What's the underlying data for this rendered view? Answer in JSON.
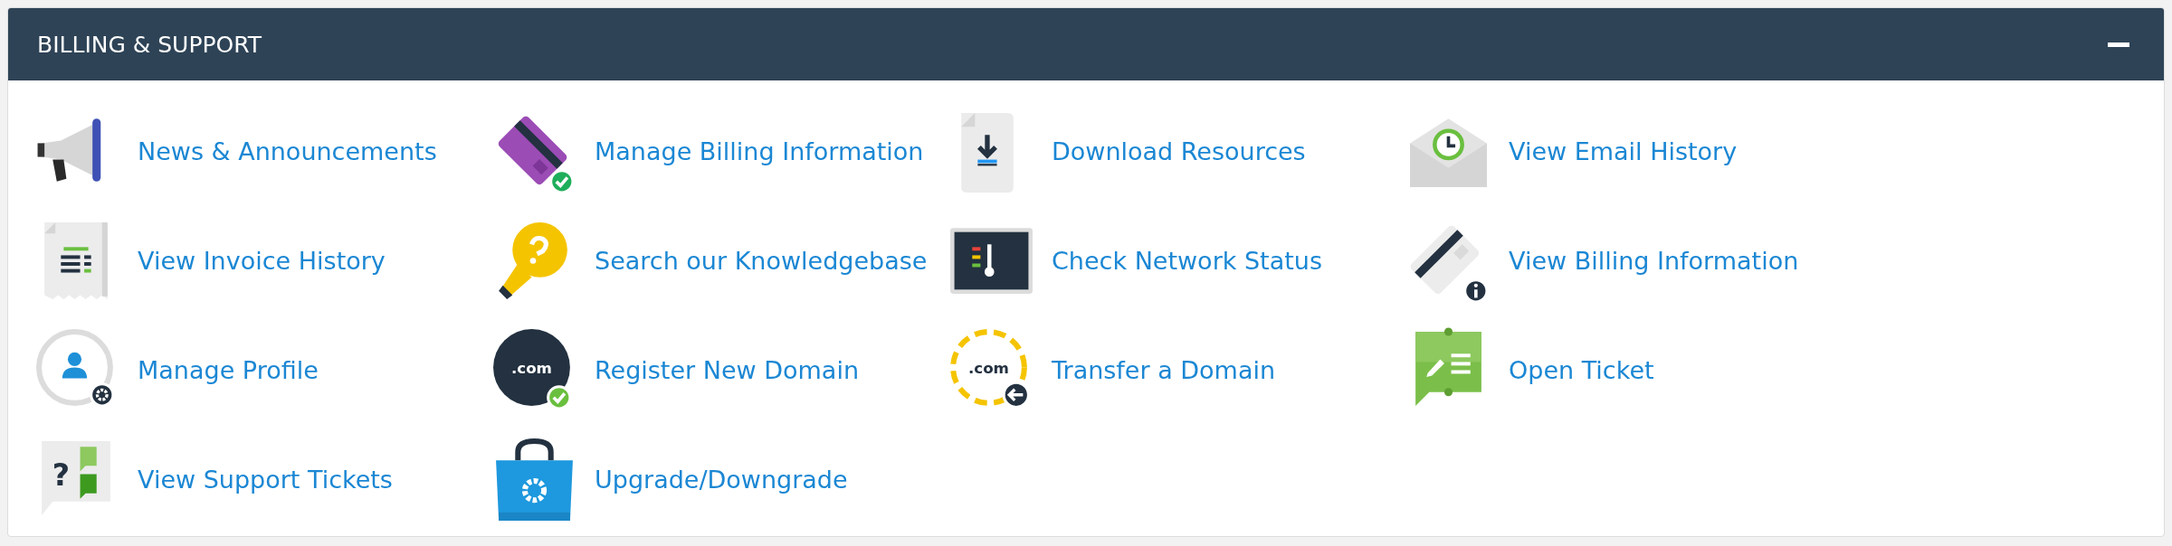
{
  "panel": {
    "title": "BILLING & SUPPORT"
  },
  "links": [
    {
      "label": "News & Announcements",
      "kind": "megaphone"
    },
    {
      "label": "Manage Billing Information",
      "kind": "cardcheck"
    },
    {
      "label": "Download Resources",
      "kind": "download"
    },
    {
      "label": "View Email History",
      "kind": "envelope"
    },
    {
      "label": "View Invoice History",
      "kind": "invoice"
    },
    {
      "label": "Search our Knowledgebase",
      "kind": "bulb"
    },
    {
      "label": "Check Network Status",
      "kind": "status"
    },
    {
      "label": "View Billing Information",
      "kind": "cardinfo"
    },
    {
      "label": "Manage Profile",
      "kind": "profile"
    },
    {
      "label": "Register New Domain",
      "kind": "domainnew",
      "icon_text": ".com"
    },
    {
      "label": "Transfer a Domain",
      "kind": "domaintransfer",
      "icon_text": ".com"
    },
    {
      "label": "Open Ticket",
      "kind": "ticket"
    },
    {
      "label": "View Support Tickets",
      "kind": "tickets",
      "icon_text": "?"
    },
    {
      "label": "Upgrade/Downgrade",
      "kind": "bag"
    }
  ]
}
